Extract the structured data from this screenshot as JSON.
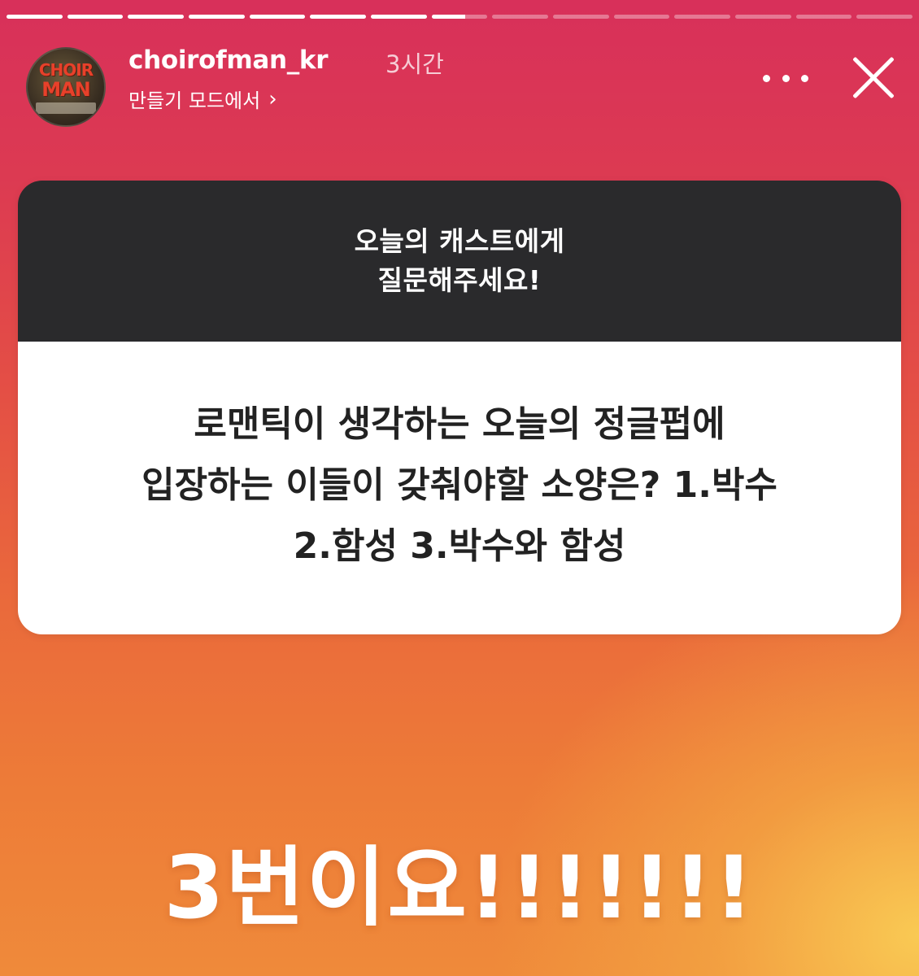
{
  "story": {
    "progress_segments": [
      1,
      1,
      1,
      1,
      1,
      1,
      1,
      0.6,
      0,
      0,
      0,
      0,
      0,
      0,
      0
    ]
  },
  "header": {
    "username": "choirofman_kr",
    "time": "3시간",
    "subtitle": "만들기 모드에서",
    "chevron": "›",
    "avatar_text_top": "CHOIR",
    "avatar_text_bottom": "MAN"
  },
  "question_card": {
    "prompt_line1": "오늘의 캐스트에게",
    "prompt_line2": "질문해주세요!",
    "question_line1": "로맨틱이 생각하는 오늘의 정글펍에",
    "question_line2": "입장하는 이들이 갖춰야할 소양은? 1.박수",
    "question_line3": "2.함성 3.박수와 함성"
  },
  "answer_text": "3번이요!!!!!!!",
  "colors": {
    "gradient_top": "#d8305a",
    "gradient_bottom": "#ef8a3a",
    "gradient_corner": "#facd55",
    "card_header": "#2a2a2c",
    "card_body": "#ffffff"
  }
}
